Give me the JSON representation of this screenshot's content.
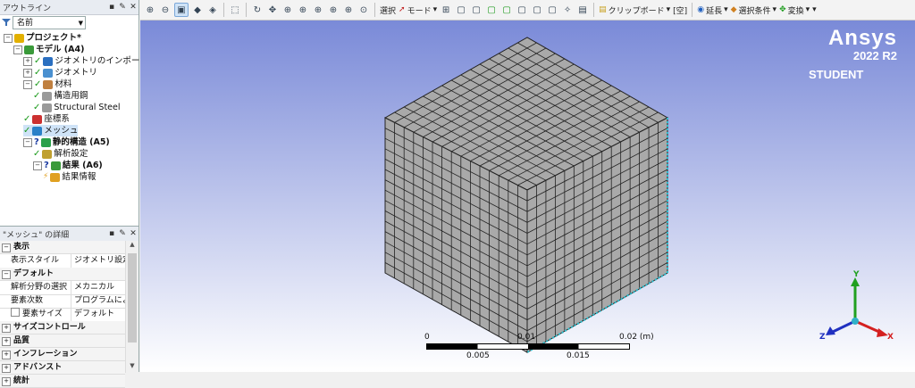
{
  "outline": {
    "title": "アウトライン",
    "pin": "▪",
    "pin2": "✎",
    "close": "✕",
    "filter_value": "名前",
    "tree": [
      {
        "label": "プロジェクト*",
        "level": 0
      },
      {
        "label": "モデル (A4)",
        "level": 1
      },
      {
        "label": "ジオメトリのインポート",
        "level": 2
      },
      {
        "label": "ジオメトリ",
        "level": 2
      },
      {
        "label": "材料",
        "level": 2
      },
      {
        "label": "構造用鋼",
        "level": 3
      },
      {
        "label": "Structural Steel",
        "level": 3
      },
      {
        "label": "座標系",
        "level": 2
      },
      {
        "label": "メッシュ",
        "level": 2
      },
      {
        "label": "静的構造 (A5)",
        "level": 2
      },
      {
        "label": "解析設定",
        "level": 3
      },
      {
        "label": "結果 (A6)",
        "level": 3
      },
      {
        "label": "結果情報",
        "level": 4
      }
    ]
  },
  "details": {
    "title": "\"メッシュ\" の詳細",
    "rows": [
      {
        "kind": "cat",
        "label": "表示",
        "sign": "−"
      },
      {
        "kind": "row",
        "label": "表示スタイル",
        "value": "ジオメトリ設定..."
      },
      {
        "kind": "cat",
        "label": "デフォルト",
        "sign": "−"
      },
      {
        "kind": "row",
        "label": "解析分野の選択",
        "value": "メカニカル"
      },
      {
        "kind": "row",
        "label": "要素次数",
        "value": "プログラムによる..."
      },
      {
        "kind": "row",
        "label": "要素サイズ",
        "value": "デフォルト",
        "checkbox": true
      },
      {
        "kind": "cat",
        "label": "サイズコントロール",
        "sign": "+"
      },
      {
        "kind": "cat",
        "label": "品質",
        "sign": "+"
      },
      {
        "kind": "cat",
        "label": "インフレーション",
        "sign": "+"
      },
      {
        "kind": "cat",
        "label": "アドバンスト",
        "sign": "+"
      },
      {
        "kind": "cat",
        "label": "統計",
        "sign": "+"
      }
    ]
  },
  "toolbar": {
    "select": "選択",
    "mode": "モード",
    "clipboard": "クリップボード",
    "empty": "[空]",
    "extend": "延長",
    "select_conditions": "選択条件",
    "transform": "変換"
  },
  "brand": {
    "name": "Ansys",
    "version": "2022 R2",
    "edition": "STUDENT"
  },
  "scale": {
    "top_labels": [
      "0",
      "0.01",
      "0.02 (m)"
    ],
    "bottom_labels": [
      "0.005",
      "0.015"
    ]
  },
  "axes": {
    "x": "X",
    "y": "Y",
    "z": "Z"
  },
  "mesh": {
    "divisions": 15
  },
  "colors": {
    "viewport_top": "#7a8ad8",
    "mesh_face": "#a9a9a9",
    "mesh_line": "#222222",
    "x_axis": "#d42020",
    "y_axis": "#20a020",
    "z_axis": "#2030c0"
  }
}
